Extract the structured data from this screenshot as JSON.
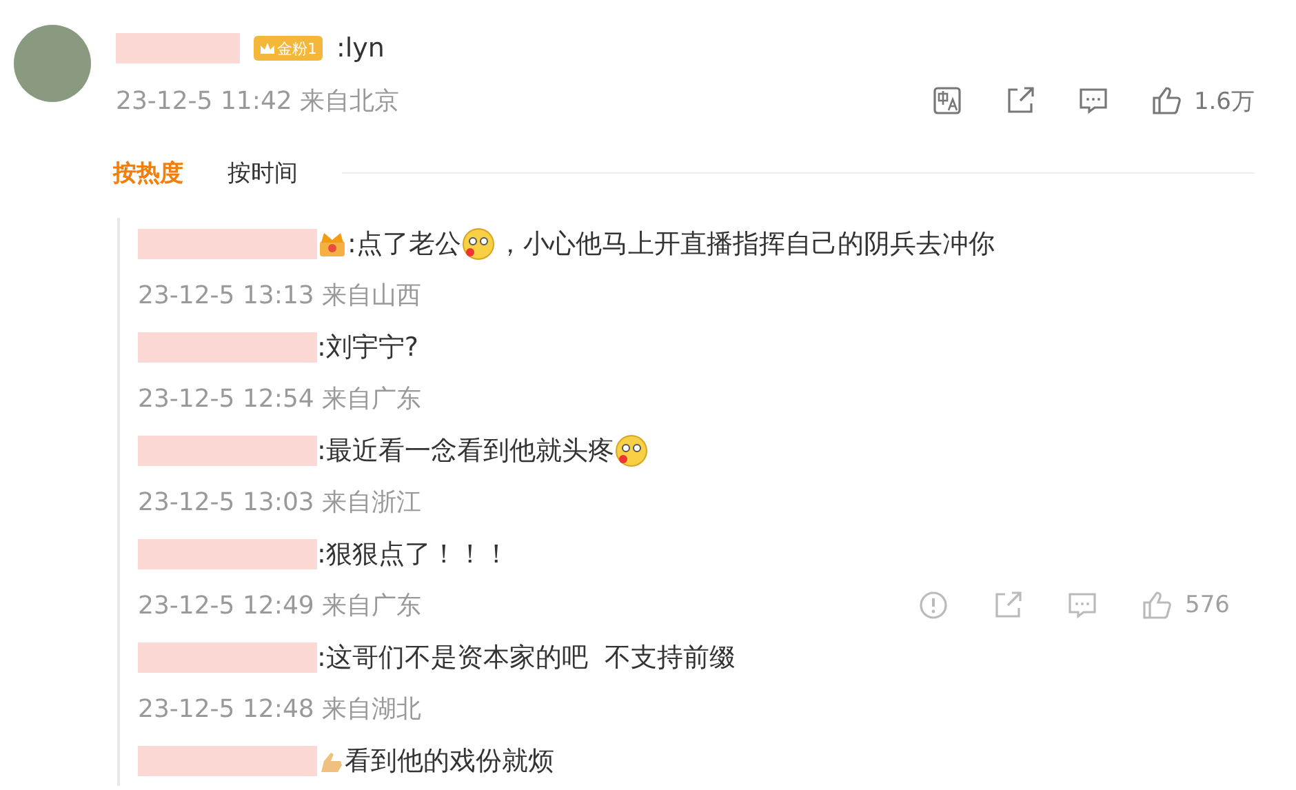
{
  "post": {
    "badge": "金粉1",
    "text": ":lyn",
    "meta": "23-12-5 11:42 来自北京",
    "likes": "1.6万"
  },
  "sort_tabs": [
    {
      "label": "按热度",
      "selected": true
    },
    {
      "label": "按时间",
      "selected": false
    }
  ],
  "replies": [
    {
      "badge": {
        "kind": "crown"
      },
      "content": [
        {
          "kind": "text",
          "text": ":点了老公"
        },
        {
          "kind": "emoji"
        },
        {
          "kind": "text",
          "text": "，小心他马上开直播指挥自己的阴兵去冲你"
        }
      ],
      "meta": "23-12-5 13:13 来自山西",
      "show_actions": false
    },
    {
      "content": [
        {
          "kind": "text",
          "text": ":刘宇宁?"
        }
      ],
      "meta": "23-12-5 12:54 来自广东",
      "show_actions": false
    },
    {
      "content": [
        {
          "kind": "text",
          "text": ":最近看一念看到他就头疼"
        },
        {
          "kind": "emoji"
        }
      ],
      "meta": "23-12-5 13:03 来自浙江",
      "show_actions": false
    },
    {
      "content": [
        {
          "kind": "text",
          "text": ":狠狠点了！！！"
        }
      ],
      "meta": "23-12-5 12:49 来自广东",
      "show_actions": true,
      "likes": "576"
    },
    {
      "content": [
        {
          "kind": "text",
          "text": ":这哥们不是资本家的吧  不支持前缀"
        }
      ],
      "meta": "23-12-5 12:48 来自湖北",
      "show_actions": false
    },
    {
      "badge": {
        "kind": "hand"
      },
      "content": [
        {
          "kind": "text",
          "text": "看到他的戏份就烦"
        }
      ]
    }
  ]
}
